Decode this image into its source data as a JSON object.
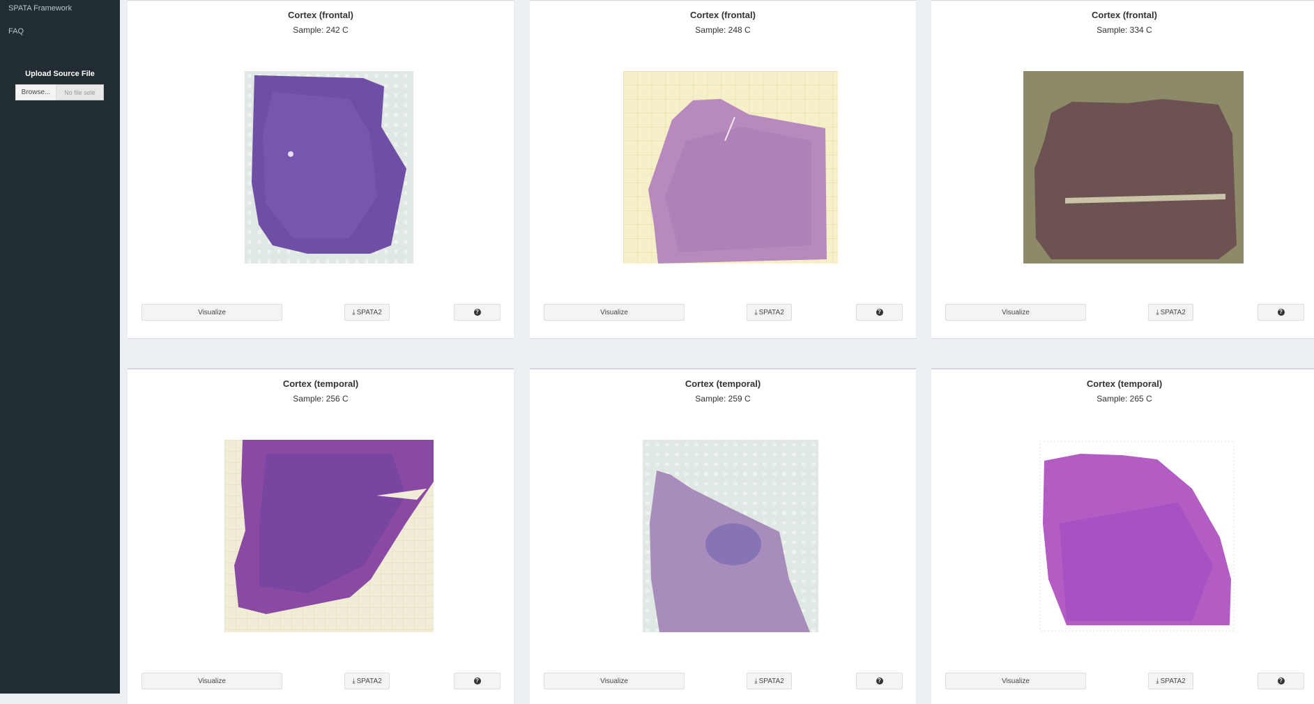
{
  "sidebar": {
    "nav": [
      {
        "label": "SPATA Framework"
      },
      {
        "label": "FAQ"
      }
    ],
    "upload": {
      "title": "Upload Source File",
      "browse_label": "Browse...",
      "file_placeholder": "No file sele"
    }
  },
  "buttons": {
    "visualize_label": "Visualize",
    "download_label": "SPATA2",
    "download_icon": "download-icon",
    "help_icon": "question-circle-icon"
  },
  "cards": [
    {
      "title": "Cortex (frontal)",
      "sample": "Sample: 242 C"
    },
    {
      "title": "Cortex (frontal)",
      "sample": "Sample: 248 C"
    },
    {
      "title": "Cortex (frontal)",
      "sample": "Sample: 334 C"
    },
    {
      "title": "Cortex (temporal)",
      "sample": "Sample: 256 C"
    },
    {
      "title": "Cortex (temporal)",
      "sample": "Sample: 259 C"
    },
    {
      "title": "Cortex (temporal)",
      "sample": "Sample: 265 C"
    }
  ],
  "colors": {
    "sidebar_bg": "#222d32",
    "content_bg": "#ecf0f5",
    "card_bg": "#ffffff"
  }
}
